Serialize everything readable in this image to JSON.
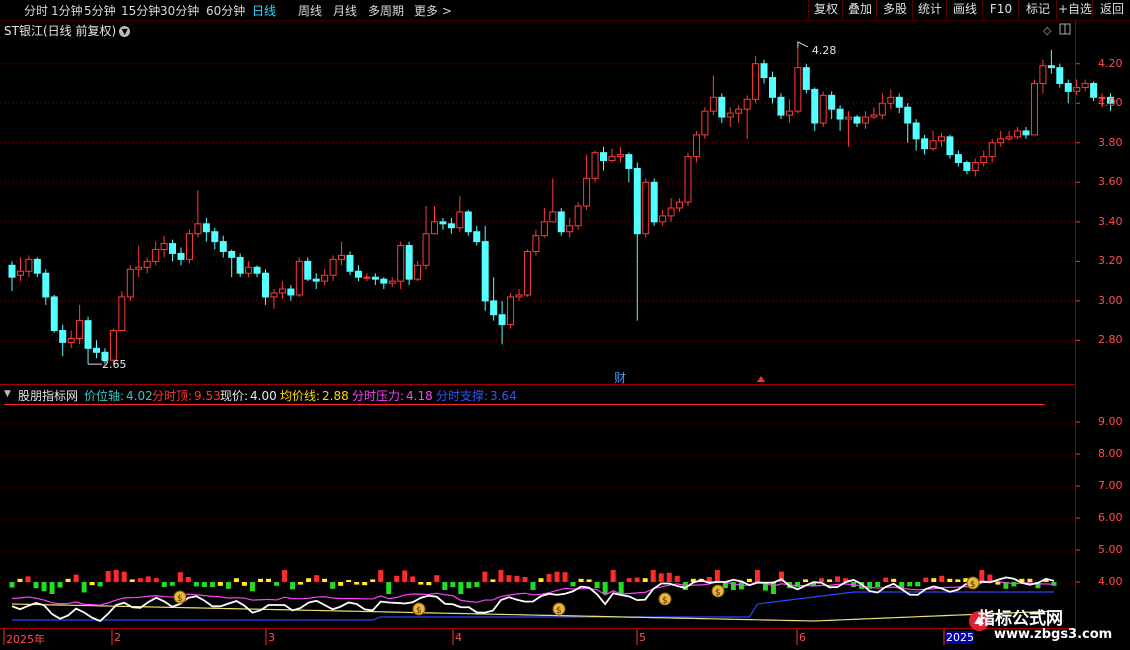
{
  "toolbar": {
    "periods": [
      "分时",
      "1分钟",
      "5分钟",
      "15分钟",
      "30分钟",
      "60分钟",
      "日线",
      "周线",
      "月线",
      "多周期",
      "更多 >"
    ],
    "active_period": "日线",
    "right_buttons": [
      "复权",
      "叠加",
      "多股",
      "统计",
      "画线",
      "F10",
      "标记",
      "+自选",
      "返回"
    ]
  },
  "stock": {
    "name": "ST银江",
    "mode": "(日线 前复权)",
    "high_label": "4.28",
    "low_label": "2.65",
    "event_label": "财"
  },
  "indicator": {
    "name": "股朋指标网",
    "items": [
      {
        "label": "价位轴:",
        "value": "4.02",
        "color": "#36c6c6"
      },
      {
        "label": "分时顶:",
        "value": "9.53",
        "color": "#ff3333"
      },
      {
        "label": "现价:",
        "value": "4.00",
        "color": "#e8e8e8"
      },
      {
        "label": "均价线:",
        "value": "2.88",
        "color": "#ffd700"
      },
      {
        "label": "分时压力:",
        "value": "4.18",
        "color": "#ff40ff"
      },
      {
        "label": "分时支撑:",
        "value": "3.64",
        "color": "#3355ff"
      }
    ]
  },
  "price_axis": [
    "4.20",
    "4.00",
    "3.80",
    "3.60",
    "3.40",
    "3.20",
    "3.00",
    "2.80"
  ],
  "indicator_axis": [
    "9.00",
    "8.00",
    "7.00",
    "6.00",
    "5.00",
    "4.00"
  ],
  "dates": [
    "2025年",
    "2",
    "3",
    "4",
    "5",
    "6",
    "2025"
  ],
  "watermark": {
    "line1": "指标公式网",
    "line2": "www.zbgs3.com"
  },
  "colors": {
    "up": "#ff3b3b",
    "down": "#54ffff",
    "grid": "#7a0000",
    "axis": "#ff4d4d"
  },
  "chart_data": {
    "type": "candlestick",
    "ylim": [
      2.62,
      4.32
    ],
    "candles": [
      [
        3.18,
        3.12,
        3.2,
        3.05
      ],
      [
        3.13,
        3.15,
        3.22,
        3.1
      ],
      [
        3.15,
        3.21,
        3.23,
        3.12
      ],
      [
        3.21,
        3.14,
        3.22,
        3.12
      ],
      [
        3.14,
        3.02,
        3.16,
        2.98
      ],
      [
        3.02,
        2.85,
        3.03,
        2.84
      ],
      [
        2.85,
        2.79,
        2.88,
        2.72
      ],
      [
        2.79,
        2.81,
        2.85,
        2.76
      ],
      [
        2.81,
        2.9,
        2.98,
        2.78
      ],
      [
        2.9,
        2.76,
        2.92,
        2.68
      ],
      [
        2.76,
        2.74,
        2.8,
        2.71
      ],
      [
        2.74,
        2.7,
        2.76,
        2.68
      ],
      [
        2.7,
        2.85,
        2.86,
        2.69
      ],
      [
        2.85,
        3.02,
        3.05,
        2.85
      ],
      [
        3.02,
        3.16,
        3.18,
        3.0
      ],
      [
        3.16,
        3.17,
        3.28,
        3.12
      ],
      [
        3.17,
        3.2,
        3.22,
        3.14
      ],
      [
        3.2,
        3.26,
        3.3,
        3.18
      ],
      [
        3.26,
        3.29,
        3.33,
        3.22
      ],
      [
        3.29,
        3.24,
        3.31,
        3.2
      ],
      [
        3.24,
        3.21,
        3.27,
        3.18
      ],
      [
        3.21,
        3.34,
        3.36,
        3.19
      ],
      [
        3.34,
        3.39,
        3.56,
        3.32
      ],
      [
        3.39,
        3.35,
        3.42,
        3.3
      ],
      [
        3.35,
        3.3,
        3.37,
        3.26
      ],
      [
        3.3,
        3.25,
        3.33,
        3.22
      ],
      [
        3.25,
        3.22,
        3.26,
        3.12
      ],
      [
        3.22,
        3.14,
        3.24,
        3.12
      ],
      [
        3.14,
        3.17,
        3.2,
        3.12
      ],
      [
        3.17,
        3.14,
        3.18,
        3.12
      ],
      [
        3.14,
        3.02,
        3.16,
        2.98
      ],
      [
        3.02,
        3.04,
        3.06,
        2.96
      ],
      [
        3.04,
        3.06,
        3.1,
        3.01
      ],
      [
        3.06,
        3.03,
        3.08,
        3.0
      ],
      [
        3.03,
        3.2,
        3.22,
        3.02
      ],
      [
        3.2,
        3.11,
        3.22,
        3.1
      ],
      [
        3.11,
        3.1,
        3.14,
        3.06
      ],
      [
        3.1,
        3.13,
        3.16,
        3.08
      ],
      [
        3.13,
        3.21,
        3.23,
        3.1
      ],
      [
        3.21,
        3.23,
        3.3,
        3.18
      ],
      [
        3.23,
        3.15,
        3.25,
        3.13
      ],
      [
        3.15,
        3.12,
        3.18,
        3.1
      ],
      [
        3.12,
        3.12,
        3.14,
        3.1
      ],
      [
        3.12,
        3.11,
        3.14,
        3.08
      ],
      [
        3.11,
        3.09,
        3.12,
        3.06
      ],
      [
        3.09,
        3.1,
        3.12,
        3.07
      ],
      [
        3.1,
        3.28,
        3.3,
        3.06
      ],
      [
        3.28,
        3.11,
        3.3,
        3.08
      ],
      [
        3.11,
        3.18,
        3.2,
        3.1
      ],
      [
        3.18,
        3.34,
        3.48,
        3.16
      ],
      [
        3.34,
        3.4,
        3.48,
        3.34
      ],
      [
        3.4,
        3.39,
        3.42,
        3.36
      ],
      [
        3.39,
        3.37,
        3.42,
        3.34
      ],
      [
        3.37,
        3.45,
        3.53,
        3.35
      ],
      [
        3.45,
        3.35,
        3.46,
        3.33
      ],
      [
        3.35,
        3.3,
        3.38,
        3.28
      ],
      [
        3.3,
        3.0,
        3.38,
        2.95
      ],
      [
        3.0,
        2.93,
        3.12,
        2.9
      ],
      [
        2.93,
        2.88,
        3.0,
        2.78
      ],
      [
        2.88,
        3.02,
        3.04,
        2.86
      ],
      [
        3.02,
        3.03,
        3.06,
        3.0
      ],
      [
        3.03,
        3.25,
        3.26,
        3.02
      ],
      [
        3.25,
        3.33,
        3.36,
        3.23
      ],
      [
        3.33,
        3.4,
        3.47,
        3.32
      ],
      [
        3.4,
        3.45,
        3.62,
        3.4
      ],
      [
        3.45,
        3.35,
        3.47,
        3.33
      ],
      [
        3.35,
        3.38,
        3.42,
        3.32
      ],
      [
        3.38,
        3.48,
        3.5,
        3.36
      ],
      [
        3.48,
        3.62,
        3.74,
        3.46
      ],
      [
        3.62,
        3.75,
        3.76,
        3.6
      ],
      [
        3.75,
        3.71,
        3.78,
        3.66
      ],
      [
        3.71,
        3.73,
        3.77,
        3.7
      ],
      [
        3.73,
        3.74,
        3.78,
        3.7
      ],
      [
        3.74,
        3.67,
        3.75,
        3.6
      ],
      [
        3.67,
        3.34,
        3.7,
        2.9
      ],
      [
        3.34,
        3.6,
        3.62,
        3.32
      ],
      [
        3.6,
        3.4,
        3.62,
        3.38
      ],
      [
        3.4,
        3.43,
        3.46,
        3.38
      ],
      [
        3.43,
        3.47,
        3.52,
        3.4
      ],
      [
        3.47,
        3.5,
        3.52,
        3.45
      ],
      [
        3.5,
        3.73,
        3.75,
        3.48
      ],
      [
        3.73,
        3.84,
        3.86,
        3.7
      ],
      [
        3.84,
        3.96,
        3.98,
        3.82
      ],
      [
        3.96,
        4.03,
        4.14,
        3.94
      ],
      [
        4.03,
        3.93,
        4.05,
        3.9
      ],
      [
        3.93,
        3.95,
        3.98,
        3.88
      ],
      [
        3.95,
        3.97,
        3.99,
        3.9
      ],
      [
        3.97,
        4.02,
        4.04,
        3.82
      ],
      [
        4.02,
        4.2,
        4.24,
        4.0
      ],
      [
        4.2,
        4.13,
        4.22,
        4.1
      ],
      [
        4.13,
        4.03,
        4.16,
        4.0
      ],
      [
        4.03,
        3.94,
        4.05,
        3.92
      ],
      [
        3.94,
        3.96,
        4.02,
        3.9
      ],
      [
        3.96,
        4.18,
        4.28,
        3.95
      ],
      [
        4.18,
        4.07,
        4.2,
        4.05
      ],
      [
        4.07,
        3.9,
        4.08,
        3.86
      ],
      [
        3.9,
        4.04,
        4.06,
        3.88
      ],
      [
        4.04,
        3.97,
        4.06,
        3.92
      ],
      [
        3.97,
        3.92,
        3.99,
        3.86
      ],
      [
        3.92,
        3.93,
        3.96,
        3.78
      ],
      [
        3.93,
        3.9,
        3.94,
        3.88
      ],
      [
        3.9,
        3.93,
        3.96,
        3.87
      ],
      [
        3.93,
        3.94,
        3.98,
        3.92
      ],
      [
        3.94,
        4.0,
        4.05,
        3.92
      ],
      [
        4.0,
        4.03,
        4.07,
        3.97
      ],
      [
        4.03,
        3.98,
        4.05,
        3.95
      ],
      [
        3.98,
        3.9,
        4.0,
        3.8
      ],
      [
        3.9,
        3.82,
        3.92,
        3.76
      ],
      [
        3.82,
        3.77,
        3.84,
        3.74
      ],
      [
        3.77,
        3.81,
        3.86,
        3.76
      ],
      [
        3.81,
        3.83,
        3.85,
        3.78
      ],
      [
        3.83,
        3.74,
        3.84,
        3.72
      ],
      [
        3.74,
        3.7,
        3.76,
        3.68
      ],
      [
        3.7,
        3.66,
        3.71,
        3.64
      ],
      [
        3.66,
        3.7,
        3.72,
        3.63
      ],
      [
        3.7,
        3.73,
        3.76,
        3.68
      ],
      [
        3.73,
        3.8,
        3.82,
        3.7
      ],
      [
        3.8,
        3.82,
        3.86,
        3.78
      ],
      [
        3.82,
        3.83,
        3.86,
        3.81
      ],
      [
        3.83,
        3.86,
        3.88,
        3.82
      ],
      [
        3.86,
        3.84,
        3.88,
        3.82
      ],
      [
        3.84,
        4.1,
        4.12,
        3.84
      ],
      [
        4.1,
        4.19,
        4.22,
        4.05
      ],
      [
        4.19,
        4.18,
        4.27,
        4.15
      ],
      [
        4.18,
        4.1,
        4.2,
        4.08
      ],
      [
        4.1,
        4.06,
        4.12,
        4.0
      ],
      [
        4.06,
        4.08,
        4.12,
        4.04
      ],
      [
        4.08,
        4.1,
        4.12,
        4.06
      ],
      [
        4.1,
        4.03,
        4.11,
        4.01
      ],
      [
        4.03,
        4.03,
        4.05,
        3.98
      ],
      [
        4.03,
        4.0,
        4.05,
        3.96
      ]
    ]
  }
}
